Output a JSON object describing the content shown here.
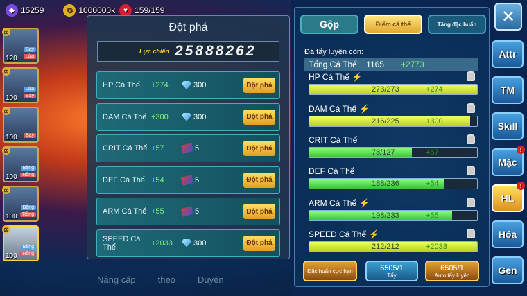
{
  "top": {
    "gems": "15259",
    "gold": "1000000k",
    "hp": "159/159"
  },
  "pets": [
    {
      "lv": "120",
      "t1": "Bay",
      "t2": "Lửa"
    },
    {
      "lv": "100",
      "t1": "Lửa",
      "t2": "Bay"
    },
    {
      "lv": "100",
      "t1": "",
      "t2": "Bay"
    },
    {
      "lv": "100",
      "t1": "Băng",
      "t2": "Rồng"
    },
    {
      "lv": "100",
      "t1": "Băng",
      "t2": "Rồng"
    },
    {
      "lv": "100",
      "t1": "Băng",
      "t2": "Rồng"
    }
  ],
  "mid": {
    "title": "Đột phá",
    "power_label": "Lực chiến",
    "power": "25888262",
    "rows": [
      {
        "name": "HP Cá Thể",
        "bonus": "+274",
        "cost": "300",
        "btn": "Đột phá"
      },
      {
        "name": "DAM Cá Thể",
        "bonus": "+300",
        "cost": "300",
        "btn": "Đột phá"
      },
      {
        "name": "CRIT Cá Thể",
        "bonus": "+57",
        "cost": "5",
        "btn": "Đột phá"
      },
      {
        "name": "DEF Cá Thể",
        "bonus": "+54",
        "cost": "5",
        "btn": "Đột phá"
      },
      {
        "name": "ARM Cá Thể",
        "bonus": "+55",
        "cost": "5",
        "btn": "Đột phá"
      },
      {
        "name": "SPEED Cá Thể",
        "bonus": "+2033",
        "cost": "300",
        "btn": "Đột phá"
      }
    ],
    "bottom_tabs": [
      "Nâng cấp",
      "theo",
      "Duyên"
    ]
  },
  "right": {
    "tabs": [
      "Gộp",
      "Điểm cá thể",
      "Tăng đặc huấn"
    ],
    "remain_label": "Đá tẩy luyện còn:",
    "total_label": "Tổng Cá Thể:",
    "total": "1165",
    "total_inc": "+2773",
    "stats": [
      {
        "name": "HP Cá Thể",
        "val": "273/273",
        "inc": "+274",
        "pct": 1.0,
        "color": "yellow",
        "bolt": true
      },
      {
        "name": "DAM Cá Thể",
        "val": "216/225",
        "inc": "+300",
        "pct": 0.96,
        "color": "yellow",
        "bolt": true
      },
      {
        "name": "CRIT Cá Thể",
        "val": "78/127",
        "inc": "+57",
        "pct": 0.61,
        "color": "green",
        "bolt": false
      },
      {
        "name": "DEF Cá Thể",
        "val": "188/236",
        "inc": "+54",
        "pct": 0.8,
        "color": "green",
        "bolt": false
      },
      {
        "name": "ARM Cá Thể",
        "val": "198/233",
        "inc": "+55",
        "pct": 0.85,
        "color": "green",
        "bolt": true
      },
      {
        "name": "SPEED Cá Thể",
        "val": "212/212",
        "inc": "+2033",
        "pct": 1.0,
        "color": "yellow",
        "bolt": true
      }
    ],
    "buttons": {
      "train": "Đặc huấn cực hạn",
      "wash_count": "6505/1",
      "wash": "Tẩy",
      "auto_count": "6505/1",
      "auto": "Auto tẩy luyện"
    }
  },
  "side": [
    "Attr",
    "TM",
    "Skill",
    "Mặc",
    "HL",
    "Hóa",
    "Gen"
  ]
}
